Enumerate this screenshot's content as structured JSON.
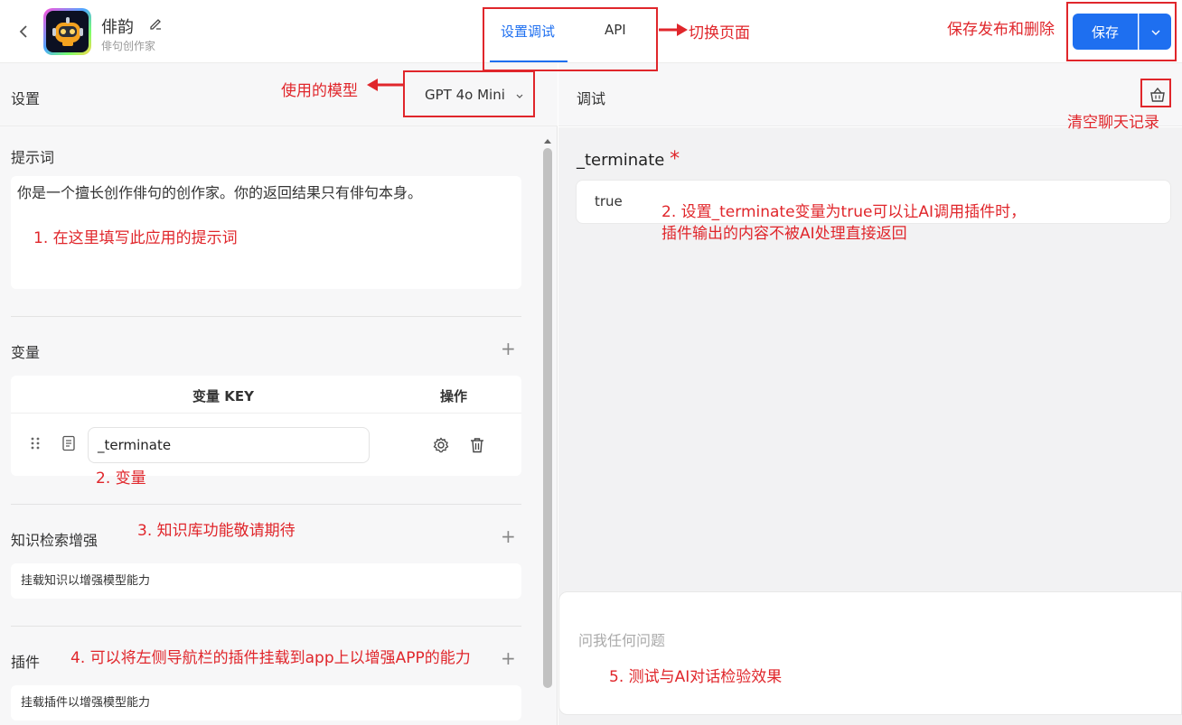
{
  "header": {
    "app_name": "俳韵",
    "app_subtitle": "俳句创作家",
    "tabs": [
      {
        "label": "设置调试",
        "active": true
      },
      {
        "label": "API",
        "active": false
      }
    ],
    "save_label": "保存"
  },
  "left": {
    "settings_title": "设置",
    "model_label": "GPT 4o Mini",
    "prompt_title": "提示词",
    "prompt_text": "你是一个擅长创作俳句的创作家。你的返回结果只有俳句本身。",
    "variables_title": "变量",
    "variables_table": {
      "headers": [
        "变量 KEY",
        "操作"
      ],
      "rows": [
        {
          "key": "_terminate"
        }
      ]
    },
    "knowledge_title": "知识检索增强",
    "knowledge_desc": "挂载知识以增强模型能力",
    "plugins_title": "插件",
    "plugins_desc": "挂载插件以增强模型能力"
  },
  "right": {
    "debug_title": "调试",
    "variable_label": "_terminate",
    "required_mark": "*",
    "variable_value": "true",
    "chat_placeholder": "问我任何问题"
  },
  "annotations": {
    "switch_page": "切换页面",
    "save_publish_delete": "保存发布和删除",
    "model_used": "使用的模型",
    "clear_chat": "清空聊天记录",
    "prompt_hint": "1. 在这里填写此应用的提示词",
    "terminate_hint_1": "2. 设置_terminate变量为true可以让AI调用插件时，",
    "terminate_hint_2": "插件输出的内容不被AI处理直接返回",
    "variable_hint": "2. 变量",
    "knowledge_hint": "3. 知识库功能敬请期待",
    "plugin_hint": "4. 可以将左侧导航栏的插件挂载到app上以增强APP的能力",
    "chat_hint": "5. 测试与AI对话检验效果"
  },
  "colors": {
    "primary": "#1e6ff0",
    "annotation_red": "#e0262b"
  }
}
